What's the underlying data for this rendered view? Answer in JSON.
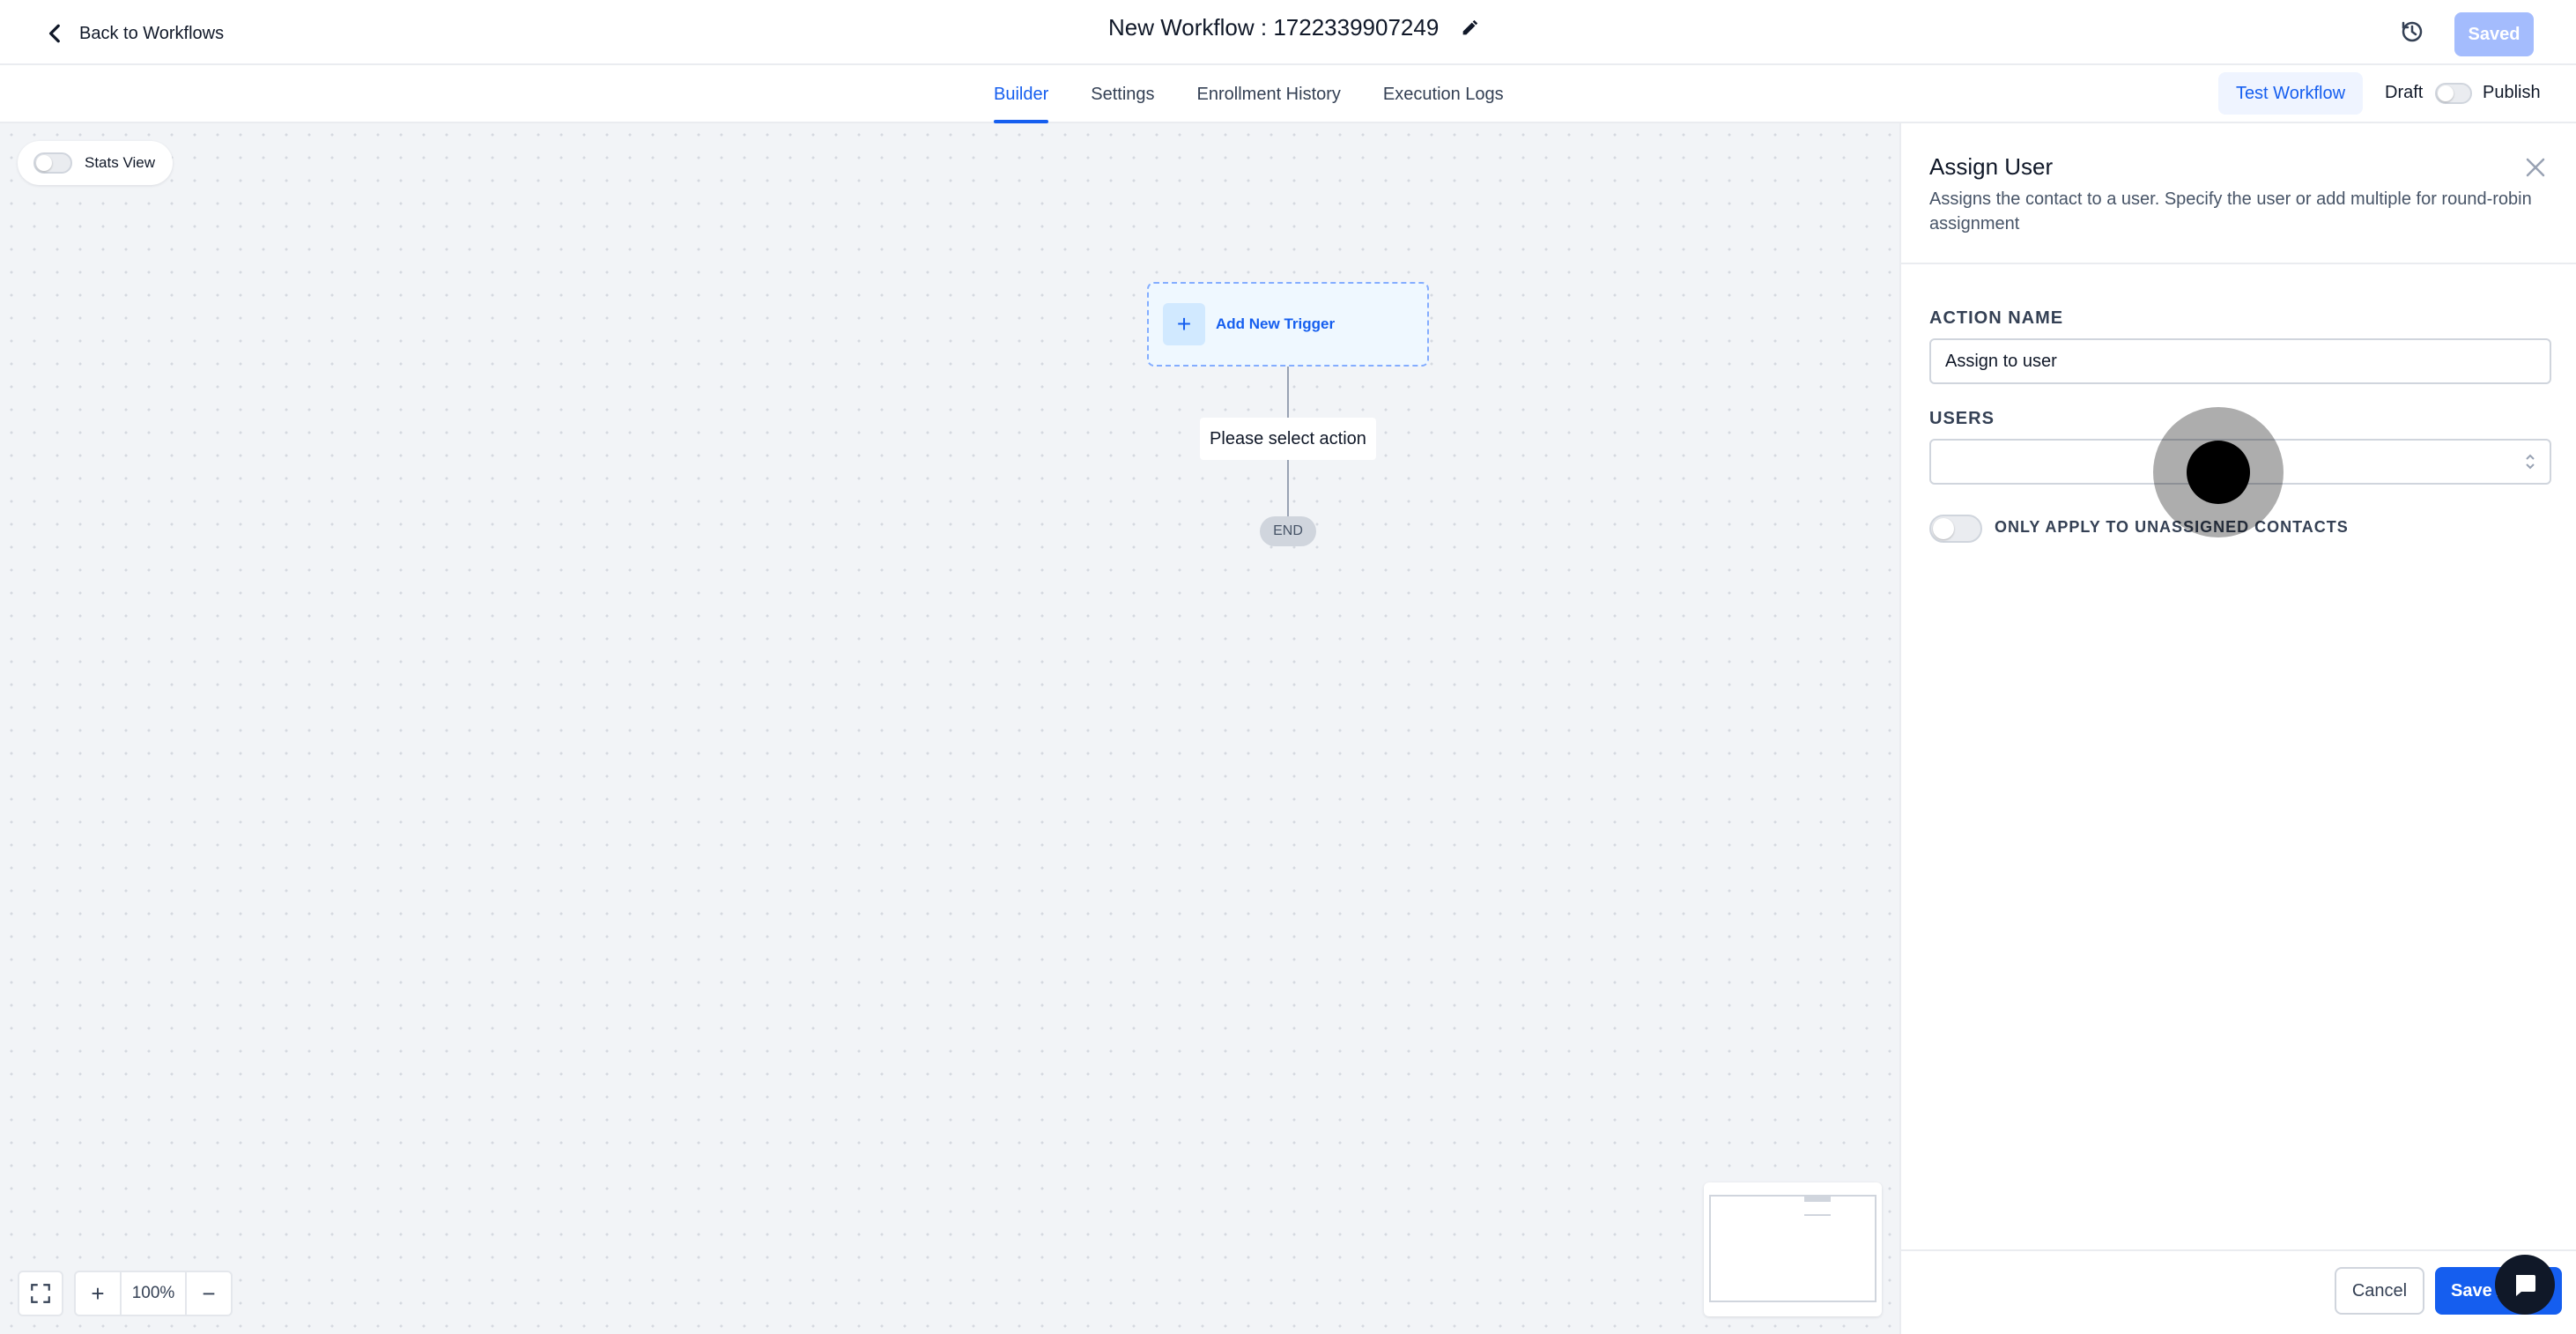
{
  "header": {
    "back_label": "Back to Workflows",
    "title": "New Workflow : 1722339907249",
    "saved_label": "Saved"
  },
  "tabs": [
    {
      "label": "Builder",
      "active": true
    },
    {
      "label": "Settings",
      "active": false
    },
    {
      "label": "Enrollment History",
      "active": false
    },
    {
      "label": "Execution Logs",
      "active": false
    }
  ],
  "toolbar": {
    "test_label": "Test Workflow",
    "draft_label": "Draft",
    "publish_label": "Publish",
    "published": false
  },
  "canvas": {
    "stats_view_label": "Stats View",
    "stats_view_on": false,
    "trigger_label": "Add New Trigger",
    "action_placeholder": "Please select action",
    "end_label": "END",
    "zoom_level": "100%"
  },
  "panel": {
    "title": "Assign User",
    "description": "Assigns the contact to a user. Specify the user or add multiple for round-robin assignment",
    "action_name_label": "ACTION NAME",
    "action_name_value": "Assign to user",
    "users_label": "USERS",
    "users_value": "",
    "unassigned_label": "ONLY APPLY TO UNASSIGNED CONTACTS",
    "unassigned_on": false,
    "cancel_label": "Cancel",
    "save_label": "Save Action"
  },
  "colors": {
    "primary": "#155eef",
    "saved_disabled": "#a4bcfd",
    "canvas_bg": "#f2f4f7"
  },
  "icons": [
    "chevron-left-icon",
    "pencil-icon",
    "history-icon",
    "plus-icon",
    "close-icon",
    "select-arrows-icon",
    "fullscreen-icon",
    "minus-icon",
    "chat-icon"
  ]
}
